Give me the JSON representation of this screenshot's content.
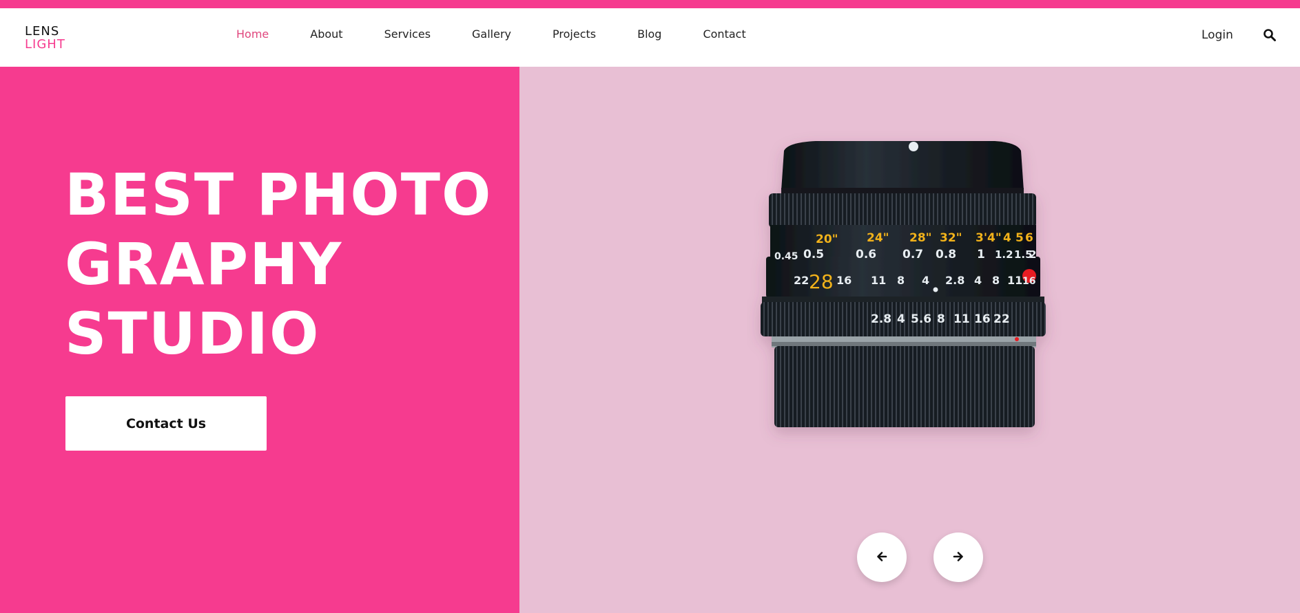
{
  "logo": {
    "line1": "LENS",
    "line2": "LIGHT"
  },
  "nav": {
    "items": [
      {
        "label": "Home",
        "active": true
      },
      {
        "label": "About"
      },
      {
        "label": "Services"
      },
      {
        "label": "Gallery"
      },
      {
        "label": "Projects"
      },
      {
        "label": "Blog"
      },
      {
        "label": "Contact"
      }
    ]
  },
  "header": {
    "login_label": "Login",
    "search_icon": "search-icon"
  },
  "hero": {
    "headline_line1": "BEST PHOTO",
    "headline_line2": "GRAPHY",
    "headline_line3": "STUDIO",
    "cta_label": "Contact Us",
    "image_alt": "camera lens",
    "lens_markings": {
      "feet": [
        "20\"",
        "24\"",
        "28\"",
        "32\"",
        "3'4\"",
        "4",
        "5",
        "6"
      ],
      "meters": [
        "0.45",
        "0.5",
        "0.6",
        "0.7",
        "0.8",
        "1",
        "1.2",
        "1.5",
        "2"
      ],
      "dof": [
        "22",
        "28",
        "16",
        "11",
        "8",
        "4",
        "2.8",
        "4",
        "8",
        "11",
        "16"
      ],
      "apertures": [
        "2.8",
        "4",
        "5.6",
        "8",
        "11",
        "16",
        "22"
      ]
    }
  },
  "slider": {
    "prev_icon": "arrow-left-icon",
    "next_icon": "arrow-right-icon"
  },
  "colors": {
    "accent": "#f63b8f",
    "hero_right_bg": "#e8bfd4",
    "nav_active": "#e0467d"
  }
}
